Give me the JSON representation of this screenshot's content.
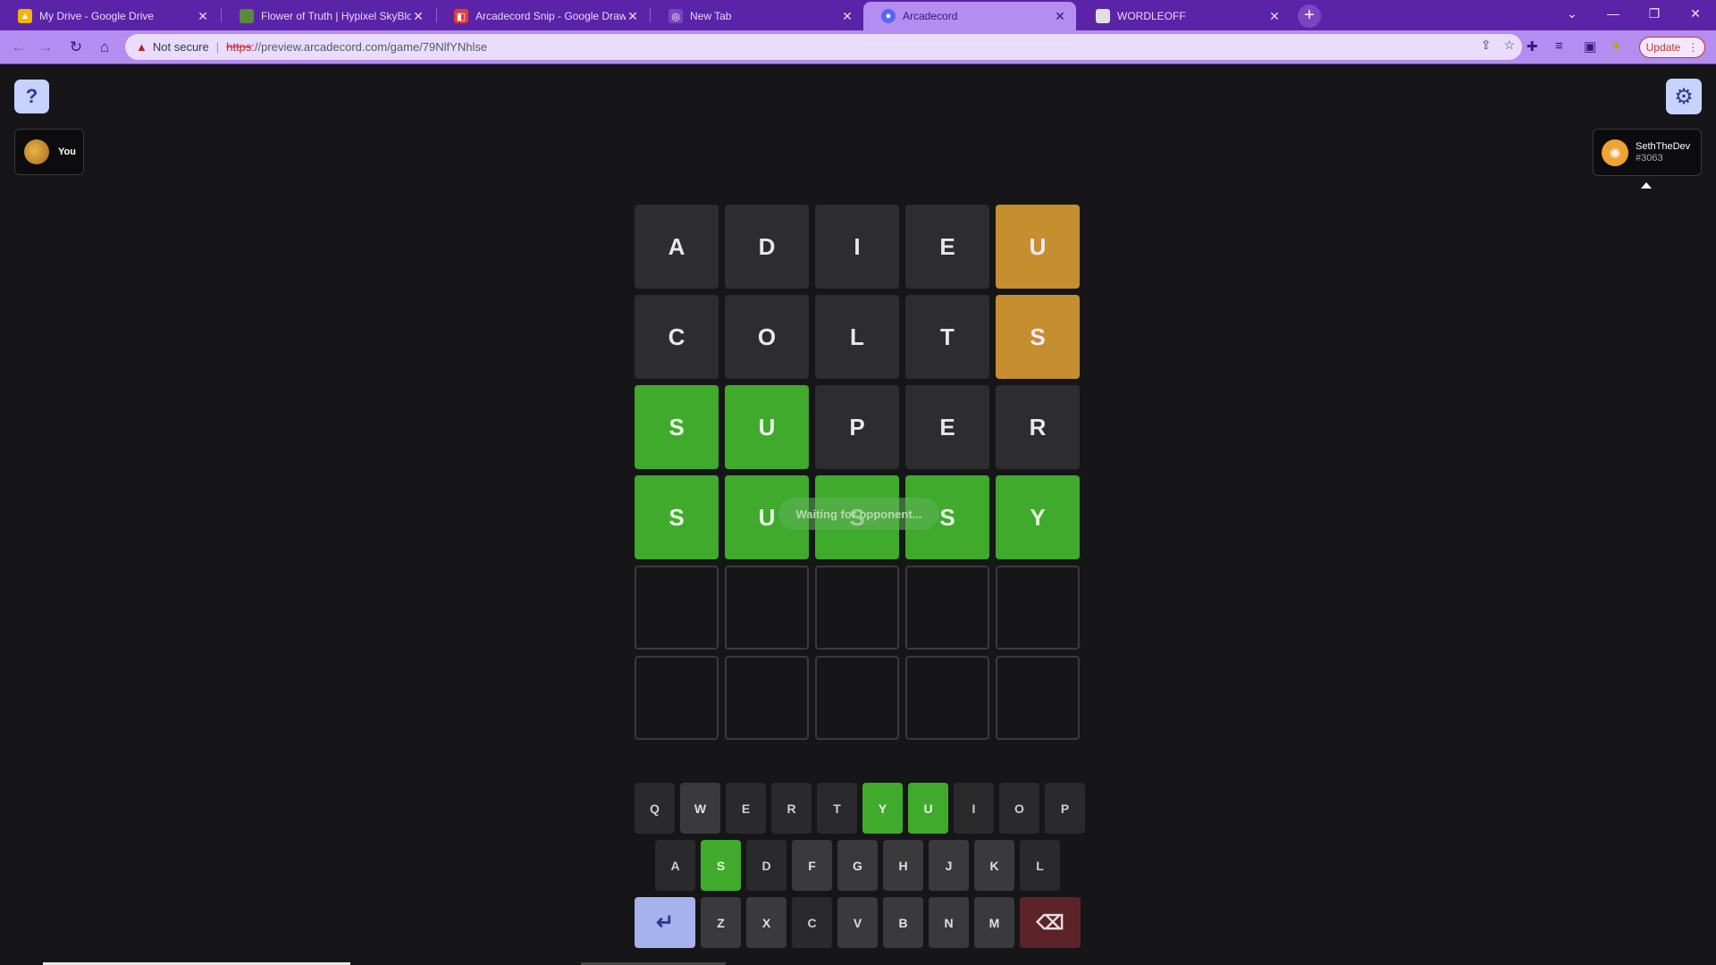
{
  "tabs": [
    {
      "title": "My Drive - Google Drive",
      "favicon": "drive-icon",
      "color": "#f4b400"
    },
    {
      "title": "Flower of Truth | Hypixel SkyBlock",
      "favicon": "grass-block-icon",
      "color": "#5a8a3a"
    },
    {
      "title": "Arcadecord Snip - Google Drawin",
      "favicon": "drawings-icon",
      "color": "#e53935"
    },
    {
      "title": "New Tab",
      "favicon": "globe-icon",
      "color": "#888"
    },
    {
      "title": "Arcadecord",
      "favicon": "arcadecord-icon",
      "color": "#5865f2"
    },
    {
      "title": "WORDLEOFF",
      "favicon": "doc-icon",
      "color": "#ddd"
    }
  ],
  "address": {
    "warning": "Not secure",
    "scheme": "https",
    "rest": "://preview.arcadecord.com/game/79NlfYNhlse"
  },
  "update_label": "Update",
  "player": {
    "label": "You"
  },
  "opponent": {
    "name": "SethTheDev",
    "tag": "#3063"
  },
  "board": [
    [
      {
        "l": "A",
        "s": "gray"
      },
      {
        "l": "D",
        "s": "gray"
      },
      {
        "l": "I",
        "s": "gray"
      },
      {
        "l": "E",
        "s": "gray"
      },
      {
        "l": "U",
        "s": "gold"
      }
    ],
    [
      {
        "l": "C",
        "s": "gray"
      },
      {
        "l": "O",
        "s": "gray"
      },
      {
        "l": "L",
        "s": "gray"
      },
      {
        "l": "T",
        "s": "gray"
      },
      {
        "l": "S",
        "s": "gold"
      }
    ],
    [
      {
        "l": "S",
        "s": "green"
      },
      {
        "l": "U",
        "s": "green"
      },
      {
        "l": "P",
        "s": "gray"
      },
      {
        "l": "E",
        "s": "gray"
      },
      {
        "l": "R",
        "s": "gray"
      }
    ],
    [
      {
        "l": "S",
        "s": "green"
      },
      {
        "l": "U",
        "s": "green"
      },
      {
        "l": "S",
        "s": "green"
      },
      {
        "l": "S",
        "s": "green"
      },
      {
        "l": "Y",
        "s": "green"
      }
    ],
    [
      {
        "l": "",
        "s": "empty"
      },
      {
        "l": "",
        "s": "empty"
      },
      {
        "l": "",
        "s": "empty"
      },
      {
        "l": "",
        "s": "empty"
      },
      {
        "l": "",
        "s": "empty"
      }
    ],
    [
      {
        "l": "",
        "s": "empty"
      },
      {
        "l": "",
        "s": "empty"
      },
      {
        "l": "",
        "s": "empty"
      },
      {
        "l": "",
        "s": "empty"
      },
      {
        "l": "",
        "s": "empty"
      }
    ]
  ],
  "toast": "Waiting for opponent...",
  "keyboard": {
    "row1": [
      {
        "k": "Q",
        "s": "dim"
      },
      {
        "k": "W",
        "s": "normal"
      },
      {
        "k": "E",
        "s": "dim"
      },
      {
        "k": "R",
        "s": "dim"
      },
      {
        "k": "T",
        "s": "dim"
      },
      {
        "k": "Y",
        "s": "green"
      },
      {
        "k": "U",
        "s": "green"
      },
      {
        "k": "I",
        "s": "dim"
      },
      {
        "k": "O",
        "s": "dim"
      },
      {
        "k": "P",
        "s": "dim"
      }
    ],
    "row2": [
      {
        "k": "A",
        "s": "dim"
      },
      {
        "k": "S",
        "s": "green"
      },
      {
        "k": "D",
        "s": "dim"
      },
      {
        "k": "F",
        "s": "normal"
      },
      {
        "k": "G",
        "s": "normal"
      },
      {
        "k": "H",
        "s": "normal"
      },
      {
        "k": "J",
        "s": "normal"
      },
      {
        "k": "K",
        "s": "normal"
      },
      {
        "k": "L",
        "s": "dim"
      }
    ],
    "row3": [
      {
        "k": "Z",
        "s": "normal"
      },
      {
        "k": "X",
        "s": "normal"
      },
      {
        "k": "C",
        "s": "dim"
      },
      {
        "k": "V",
        "s": "normal"
      },
      {
        "k": "B",
        "s": "normal"
      },
      {
        "k": "N",
        "s": "normal"
      },
      {
        "k": "M",
        "s": "normal"
      }
    ]
  }
}
